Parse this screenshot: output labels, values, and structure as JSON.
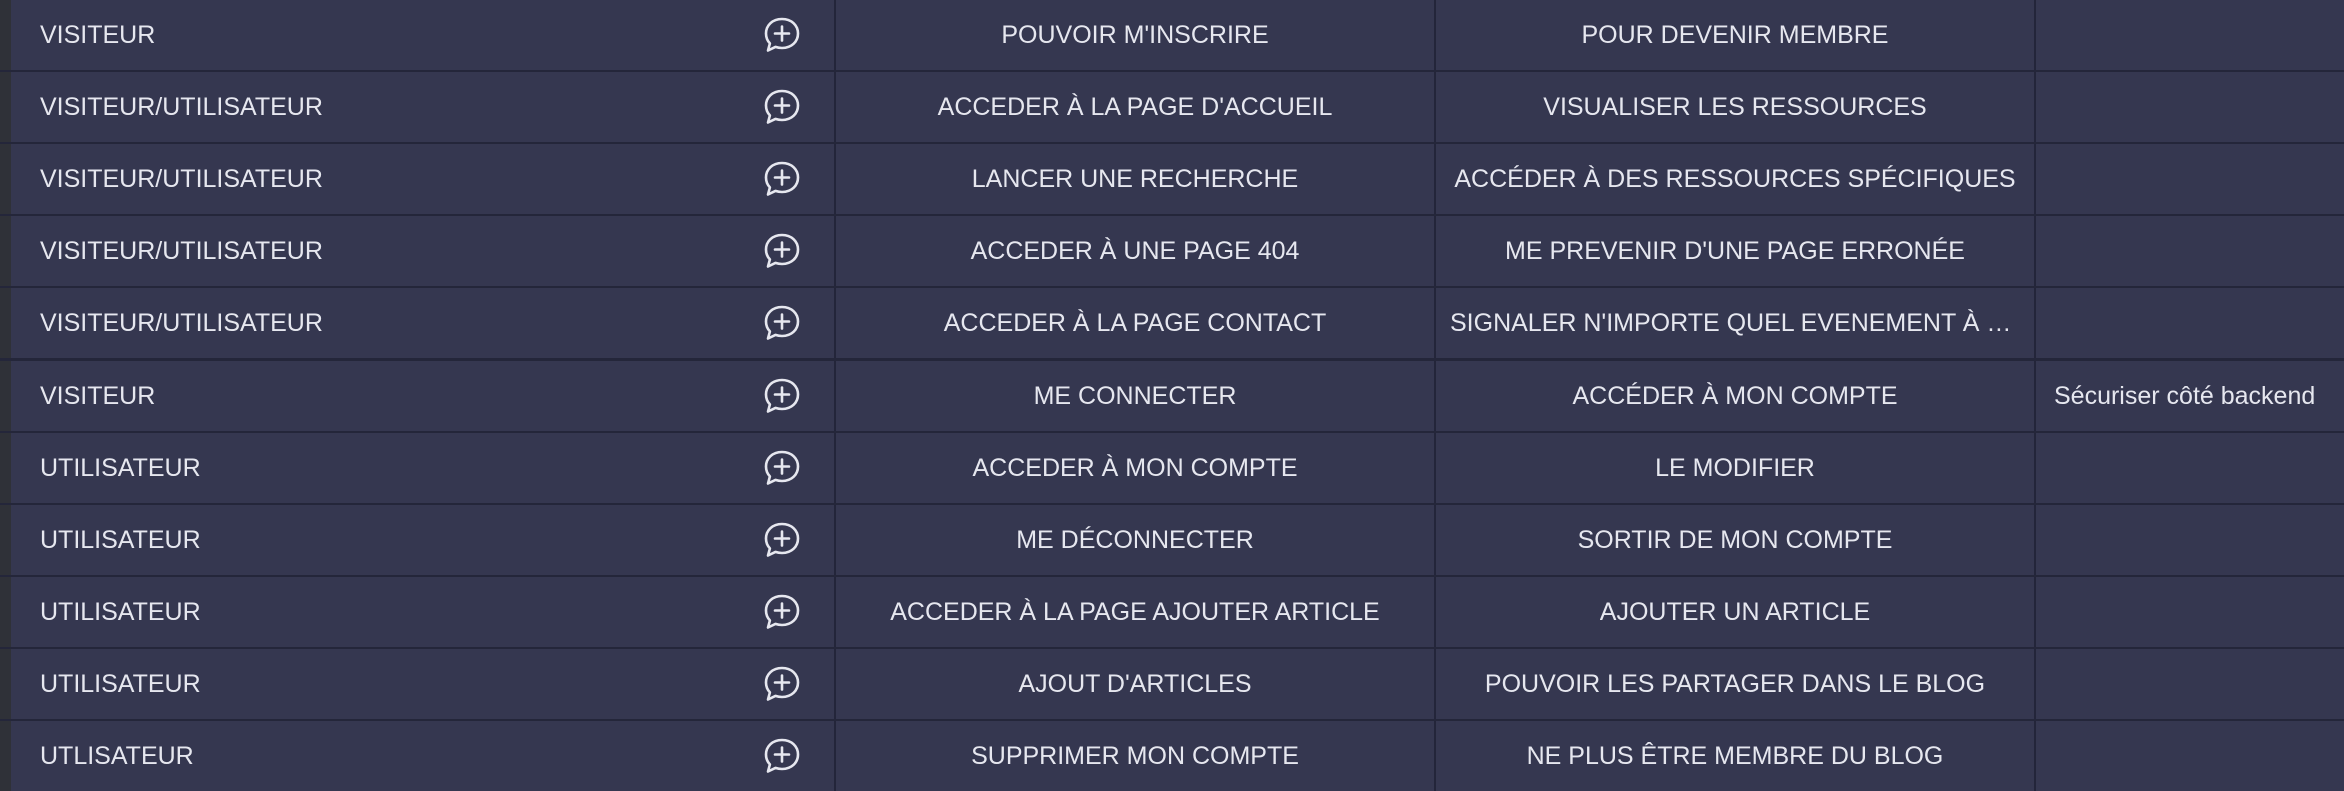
{
  "rows": [
    {
      "role": "VISITEUR",
      "action": "POUVOIR M'INSCRIRE",
      "goal": "POUR DEVENIR MEMBRE",
      "note": ""
    },
    {
      "role": "VISITEUR/UTILISATEUR",
      "action": "ACCEDER À LA PAGE D'ACCUEIL",
      "goal": "VISUALISER LES RESSOURCES",
      "note": ""
    },
    {
      "role": "VISITEUR/UTILISATEUR",
      "action": "LANCER UNE RECHERCHE",
      "goal": "ACCÉDER À DES RESSOURCES SPÉCIFIQUES",
      "note": ""
    },
    {
      "role": "VISITEUR/UTILISATEUR",
      "action": "ACCEDER À UNE PAGE 404",
      "goal": "ME PREVENIR D'UNE PAGE ERRONÉE",
      "note": ""
    },
    {
      "role": "VISITEUR/UTILISATEUR",
      "action": "ACCEDER À LA PAGE CONTACT",
      "goal": "SIGNALER N'IMPORTE QUEL EVENEMENT À L'A…",
      "note": ""
    },
    {
      "role": "VISITEUR",
      "action": "ME CONNECTER",
      "goal": "ACCÉDER À MON COMPTE",
      "note": "Sécuriser côté backend"
    },
    {
      "role": "UTILISATEUR",
      "action": "ACCEDER À MON COMPTE",
      "goal": "LE MODIFIER",
      "note": ""
    },
    {
      "role": "UTILISATEUR",
      "action": "ME DÉCONNECTER",
      "goal": "SORTIR DE MON COMPTE",
      "note": ""
    },
    {
      "role": "UTILISATEUR",
      "action": "ACCEDER À LA PAGE AJOUTER ARTICLE",
      "goal": "AJOUTER UN ARTICLE",
      "note": ""
    },
    {
      "role": "UTILISATEUR",
      "action": "AJOUT D'ARTICLES",
      "goal": "POUVOIR LES PARTAGER DANS LE BLOG",
      "note": ""
    },
    {
      "role": "UTLISATEUR",
      "action": "SUPPRIMER MON COMPTE",
      "goal": "NE PLUS ÊTRE MEMBRE DU BLOG",
      "note": ""
    }
  ],
  "icons": {
    "add_comment": "add-comment-icon"
  },
  "colors": {
    "row_bg": "#353750",
    "divider": "#23253a",
    "text": "#e6e7ef"
  }
}
